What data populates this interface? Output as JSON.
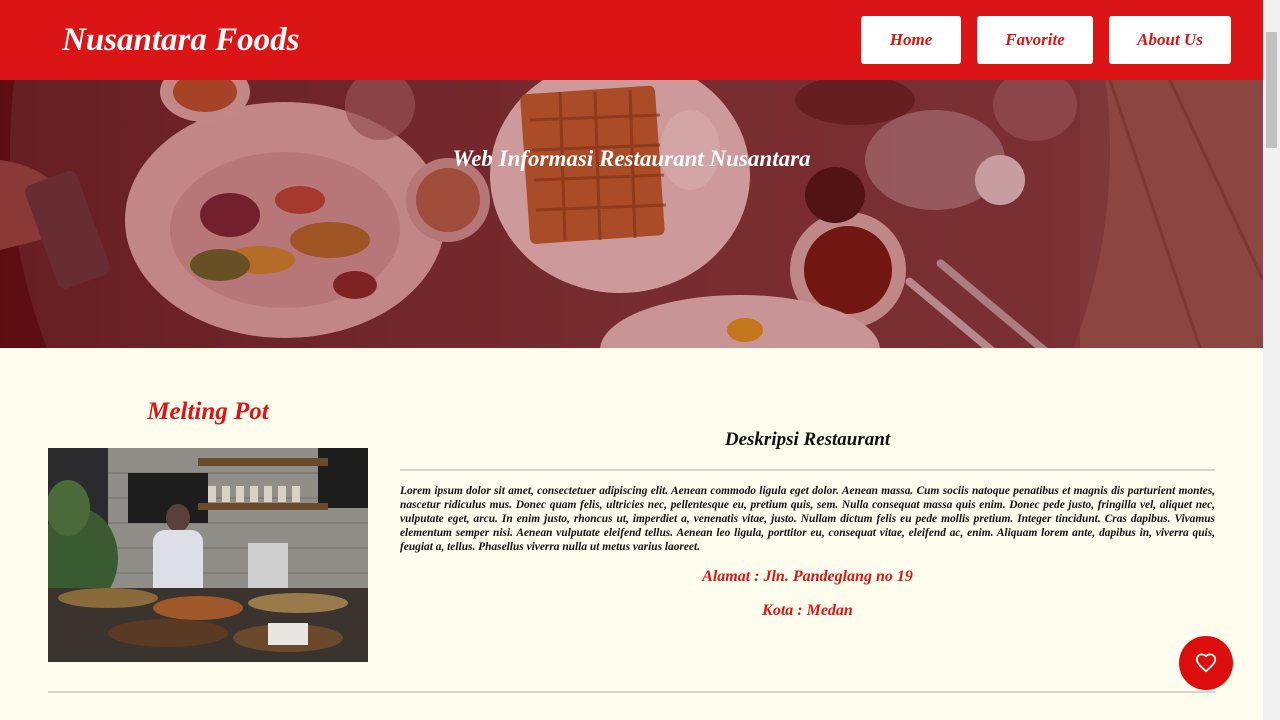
{
  "header": {
    "brand": "Nusantara Foods",
    "nav": {
      "home": "Home",
      "favorite": "Favorite",
      "about": "About Us"
    }
  },
  "hero": {
    "title": "Web Informasi Restaurant Nusantara"
  },
  "restaurant": {
    "name": "Melting Pot",
    "description_title": "Deskripsi Restaurant",
    "description": "Lorem ipsum dolor sit amet, consectetuer adipiscing elit. Aenean commodo ligula eget dolor. Aenean massa. Cum sociis natoque penatibus et magnis dis parturient montes, nascetur ridiculus mus. Donec quam felis, ultricies nec, pellentesque eu, pretium quis, sem. Nulla consequat massa quis enim. Donec pede justo, fringilla vel, aliquet nec, vulputate eget, arcu. In enim justo, rhoncus ut, imperdiet a, venenatis vitae, justo. Nullam dictum felis eu pede mollis pretium. Integer tincidunt. Cras dapibus. Vivamus elementum semper nisi. Aenean vulputate eleifend tellus. Aenean leo ligula, porttitor eu, consequat vitae, eleifend ac, enim. Aliquam lorem ante, dapibus in, viverra quis, feugiat a, tellus. Phasellus viverra nulla ut metus varius laoreet.",
    "address": "Alamat : Jln. Pandeglang no 19",
    "city": "Kota : Medan"
  },
  "icons": {
    "favorite_button": "heart-icon"
  },
  "colors": {
    "primary": "#db1515",
    "background": "#fffdee",
    "nav_button_bg": "#ffffff"
  }
}
